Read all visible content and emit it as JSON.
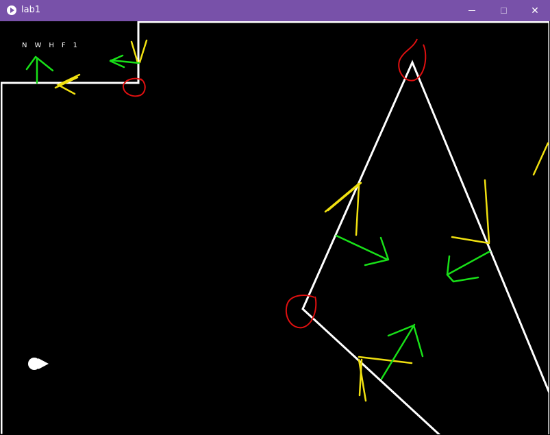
{
  "window": {
    "title": "lab1",
    "minimize_icon": "minimize-icon",
    "maximize_icon": "maximize-icon",
    "close_icon": "close-icon",
    "close_glyph": "✕",
    "accent": "#7851a9"
  },
  "hud": {
    "labels": [
      "N",
      "W",
      "H",
      "F",
      "1"
    ]
  },
  "scene": {
    "background": "#000000",
    "wall_color": "#ffffff",
    "annotation_colors": {
      "corner_marks": "#e01010",
      "normals_green": "#18e018",
      "edges_yellow": "#f0e010"
    }
  }
}
